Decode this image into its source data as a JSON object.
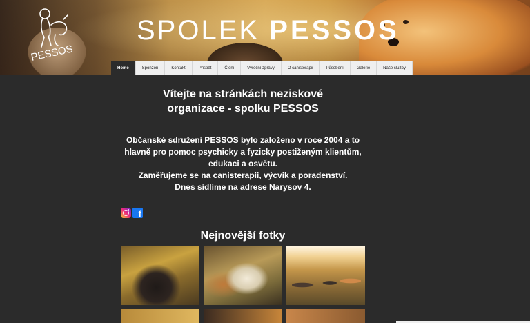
{
  "banner": {
    "title_light": "SPOLEK",
    "title_bold": "PESSOS",
    "logo_text": "PESSOS"
  },
  "nav": {
    "items": [
      {
        "label": "Home",
        "active": true
      },
      {
        "label": "Sponzoři"
      },
      {
        "label": "Kontakt"
      },
      {
        "label": "Přispět"
      },
      {
        "label": "Členi"
      },
      {
        "label": "Výroční zprávy"
      },
      {
        "label": "O canisterapii"
      },
      {
        "label": "Působení"
      },
      {
        "label": "Galerie"
      },
      {
        "label": "Naše služby"
      }
    ]
  },
  "main": {
    "heading_line1": "Vítejte na stránkách neziskové",
    "heading_line2": "organizace - spolku PESSOS",
    "intro_lines": [
      "Občanské sdružení PESSOS bylo založeno v roce 2004 a to",
      "hlavně pro pomoc psychicky a fyzicky postiženým klientům,",
      "edukaci a osvětu.",
      "Zaměřujeme se na canisterapii, výcvik a poradenství.",
      "Dnes sídlíme na adrese Narysov 4."
    ],
    "social": {
      "instagram_icon": "instagram-icon",
      "facebook_icon": "facebook-icon",
      "facebook_glyph": "f"
    },
    "photos_title": "Nejnovější fotky"
  },
  "colors": {
    "background": "#2b2b2b",
    "nav_bg": "#efefef",
    "active_tab": "#2b2b2b",
    "text": "#ffffff"
  }
}
